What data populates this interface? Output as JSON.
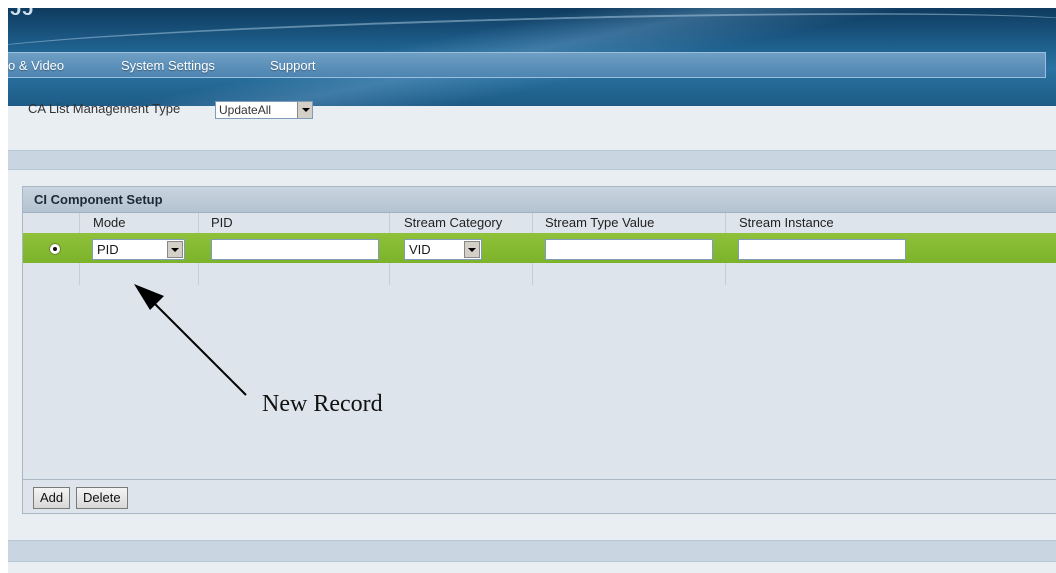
{
  "header": {
    "logo_fragment": "ɔɔ"
  },
  "nav": {
    "items": [
      {
        "label": "o & Video"
      },
      {
        "label": "System Settings"
      },
      {
        "label": "Support"
      }
    ]
  },
  "ca_list": {
    "label": "CA List Management Type",
    "selected": "UpdateAll"
  },
  "ci_component_setup": {
    "title": "CI Component Setup",
    "columns": [
      "Mode",
      "PID",
      "Stream Category",
      "Stream Type Value",
      "Stream Instance"
    ],
    "rows": [
      {
        "selected": true,
        "mode": "PID",
        "pid": "",
        "stream_category": "VID",
        "stream_type_value": "",
        "stream_instance": ""
      }
    ],
    "buttons": {
      "add": "Add",
      "delete": "Delete"
    }
  },
  "annotation": {
    "label": "New Record"
  },
  "colors": {
    "header_dark": "#0e3a5e",
    "header_mid": "#2a73a3",
    "row_highlight": "#86bb33",
    "panel_bg": "#dde4eb"
  }
}
